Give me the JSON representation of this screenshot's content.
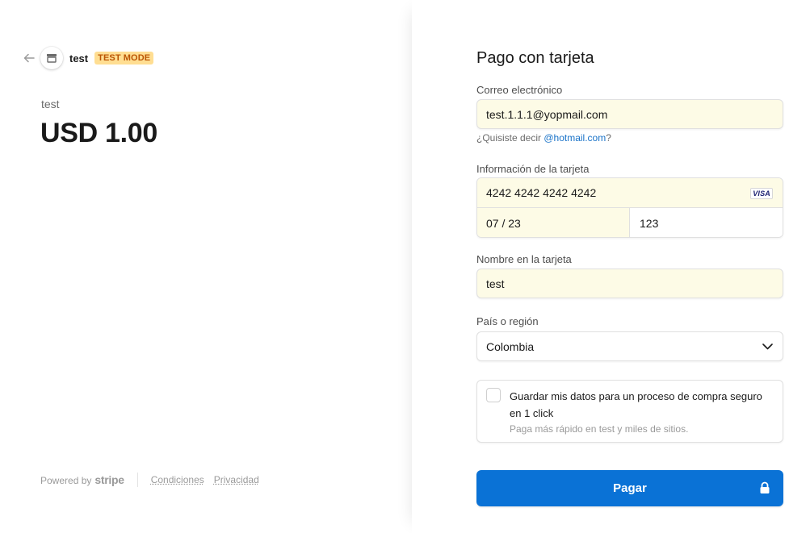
{
  "header": {
    "merchant_name": "test",
    "badge": "TEST MODE"
  },
  "product": {
    "name": "test",
    "amount": "USD 1.00"
  },
  "footer": {
    "powered_by": "Powered by",
    "brand": "stripe",
    "terms": "Condiciones",
    "privacy": "Privacidad"
  },
  "form": {
    "title": "Pago con tarjeta",
    "email_label": "Correo electrónico",
    "email_value": "test.1.1.1@yopmail.com",
    "suggestion_prefix": "¿Quisiste decir ",
    "suggestion_link": "@hotmail.com",
    "suggestion_suffix": "?",
    "card_label": "Información de la tarjeta",
    "card_number": "4242 4242 4242 4242",
    "card_brand": "VISA",
    "card_expiry": "07 / 23",
    "card_cvc": "123",
    "name_label": "Nombre en la tarjeta",
    "name_value": "test",
    "country_label": "País o región",
    "country_value": "Colombia",
    "save_main": "Guardar mis datos para un proceso de compra seguro en 1 click",
    "save_sub": "Paga más rápido en test y miles de sitios.",
    "pay_label": "Pagar"
  },
  "colors": {
    "pay_button": "#0a72d6",
    "autofill_bg": "#fdfbe6",
    "badge_bg": "#ffde92",
    "badge_text": "#bb5504",
    "link": "#1a73c8"
  },
  "icons": [
    "back-arrow-icon",
    "store-icon",
    "visa-icon",
    "chevron-down-icon",
    "lock-icon"
  ]
}
